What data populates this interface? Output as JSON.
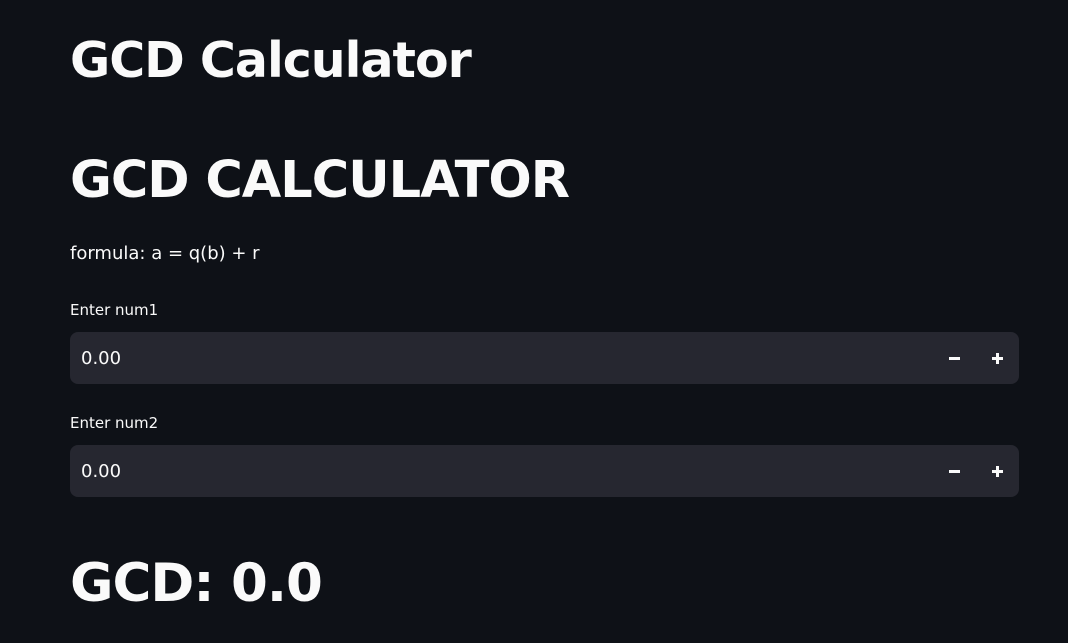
{
  "page_title": "GCD Calculator",
  "section_title": "GCD CALCULATOR",
  "formula_text": "formula: a = q(b) + r",
  "inputs": [
    {
      "label": "Enter num1",
      "value": "0.00",
      "decrement_icon": "minus-icon",
      "increment_icon": "plus-icon"
    },
    {
      "label": "Enter num2",
      "value": "0.00",
      "decrement_icon": "minus-icon",
      "increment_icon": "plus-icon"
    }
  ],
  "result_text": "GCD: 0.0",
  "colors": {
    "background": "#0e1117",
    "input_background": "#262730",
    "text": "#fafafa"
  }
}
